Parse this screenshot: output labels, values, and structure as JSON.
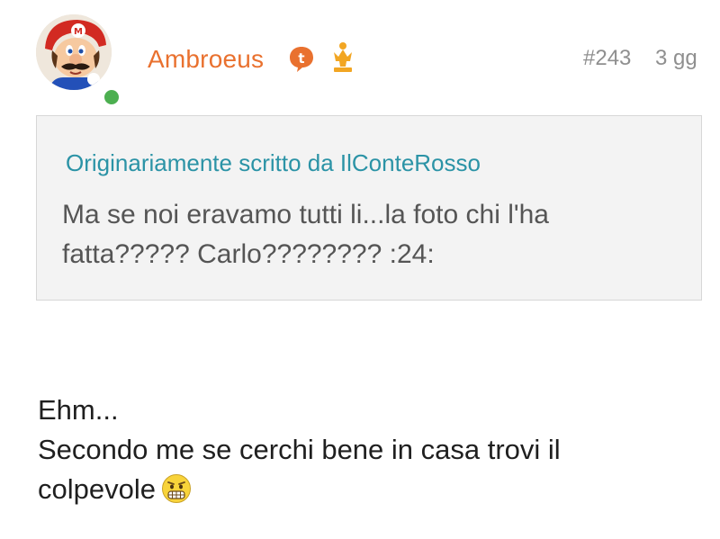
{
  "post": {
    "author": {
      "username": "Ambroeus",
      "avatar_icon": "mario-avatar-icon",
      "online_status": "online",
      "badges": [
        "t-badge-icon",
        "crown-icon"
      ]
    },
    "meta": {
      "number": "#243",
      "age": "3 gg"
    },
    "quote": {
      "author_line": "Originariamente scritto da IlConteRosso",
      "text": "Ma se noi eravamo tutti li...la foto chi l'ha fatta????? Carlo???????? :24:"
    },
    "message": {
      "line1": "Ehm...",
      "line2": "Secondo me se cerchi bene in casa trovi il",
      "line3": "colpevole",
      "emoji_icon": "grimacing-face-icon"
    },
    "colors": {
      "username": "#e9712f",
      "quote_author": "#2b93a6",
      "meta": "#8f8f8f",
      "online": "#4caf50"
    }
  }
}
